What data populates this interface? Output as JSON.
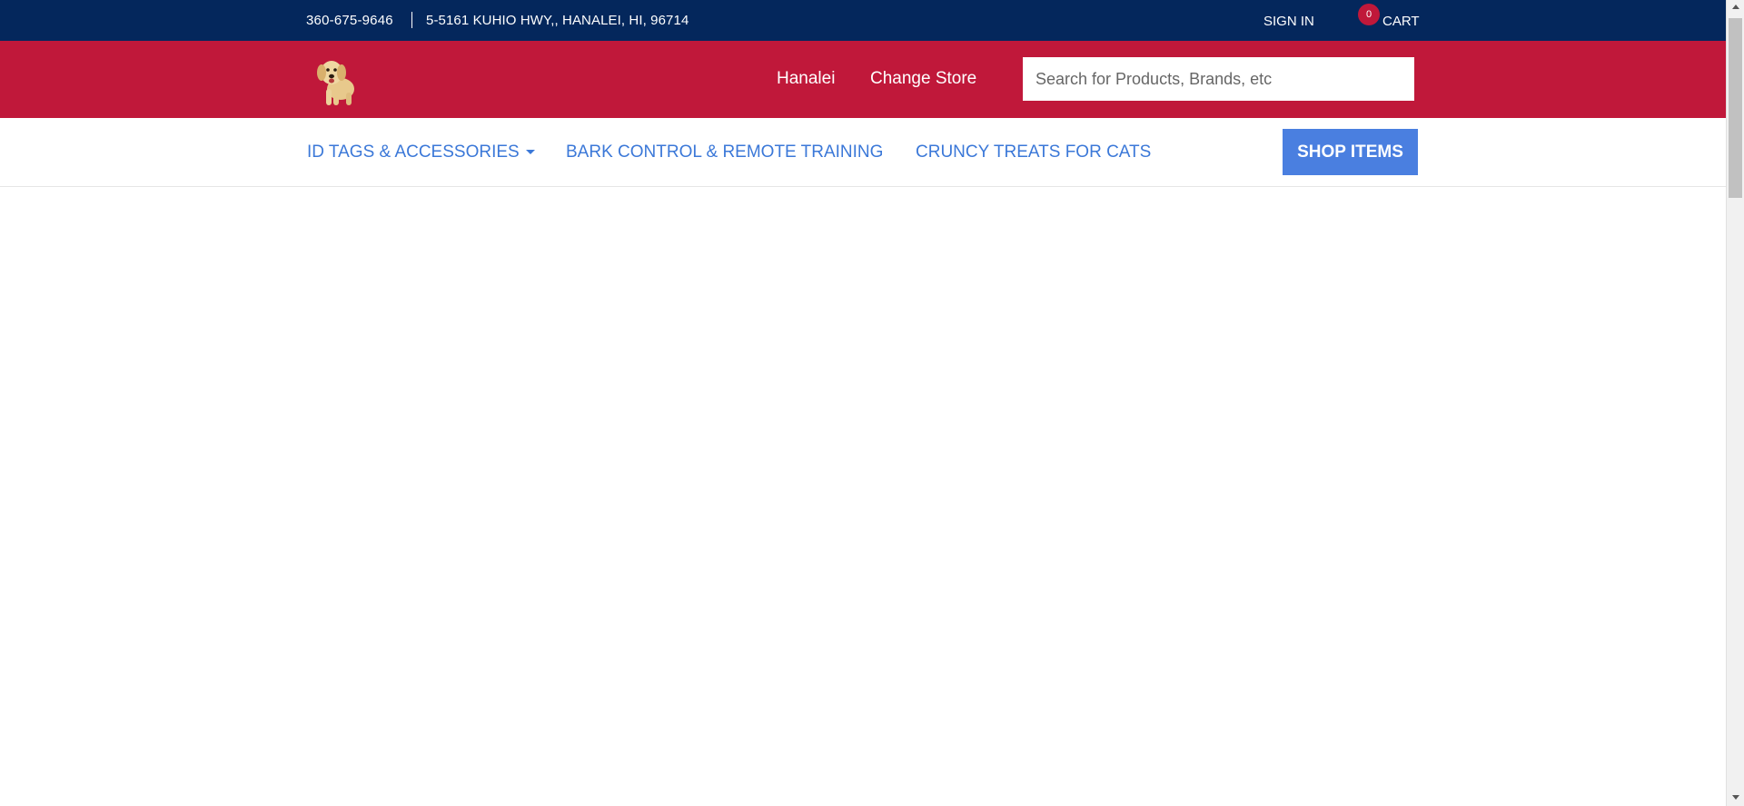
{
  "topbar": {
    "phone": "360-675-9646",
    "address": "5-5161 KUHIO HWY,, HANALEI, HI, 96714",
    "sign_in": "SIGN IN",
    "cart_count": "0",
    "cart_label": "CART"
  },
  "header": {
    "store_name": "Hanalei",
    "change_store": "Change Store",
    "search_placeholder": "Search for Products, Brands, etc",
    "logo_icon": "puppy-logo-icon"
  },
  "nav": {
    "items": [
      {
        "label": "ID TAGS & ACCESSORIES",
        "has_dropdown": true
      },
      {
        "label": "BARK CONTROL & REMOTE TRAINING",
        "has_dropdown": false
      },
      {
        "label": "CRUNCY TREATS FOR CATS",
        "has_dropdown": false
      }
    ],
    "shop_button": "SHOP ITEMS"
  },
  "colors": {
    "topbar_bg": "#04275c",
    "header_bg": "#c0183a",
    "nav_link": "#3b78d8",
    "shop_button_bg": "#4a7fe0",
    "badge_bg": "#c0183a"
  }
}
